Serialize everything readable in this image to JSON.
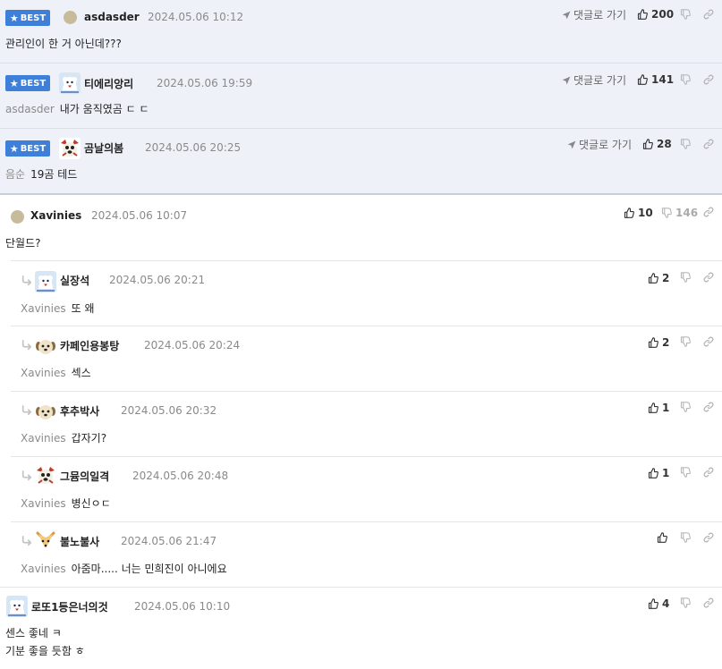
{
  "ui": {
    "best_label": "BEST",
    "goto_label": "댓글로 가기"
  },
  "best_comments": [
    {
      "nickname": "asdasder",
      "date": "2024.05.06 10:12",
      "mention": "",
      "text": "관리인이 한 거 아닌데???",
      "likes": "200",
      "avatar": "dot"
    },
    {
      "nickname": "티에리앙리",
      "date": "2024.05.06 19:59",
      "mention": "asdasder",
      "text": "내가 움직였곰 ㄷ ㄷ",
      "likes": "141",
      "avatar": "bear"
    },
    {
      "nickname": "곰날의봄",
      "date": "2024.05.06 20:25",
      "mention": "음순",
      "text": "19곰 테드",
      "likes": "28",
      "avatar": "dog"
    }
  ],
  "comments": [
    {
      "nickname": "Xavinies",
      "date": "2024.05.06 10:07",
      "text": "단월드?",
      "likes": "10",
      "dislikes": "146",
      "avatar": "dot"
    },
    {
      "nickname": "실장석",
      "date": "2024.05.06 20:21",
      "mention": "Xavinies",
      "text": "또 왜",
      "likes": "2",
      "avatar": "bear"
    },
    {
      "nickname": "카페인용봉탕",
      "date": "2024.05.06 20:24",
      "mention": "Xavinies",
      "text": "섹스",
      "likes": "2",
      "avatar": "puppy"
    },
    {
      "nickname": "후추박사",
      "date": "2024.05.06 20:32",
      "mention": "Xavinies",
      "text": "갑자기?",
      "likes": "1",
      "avatar": "puppy"
    },
    {
      "nickname": "그뮴의일격",
      "date": "2024.05.06 20:48",
      "mention": "Xavinies",
      "text": "병신ㅇㄷ",
      "likes": "1",
      "avatar": "dog"
    },
    {
      "nickname": "불노불사",
      "date": "2024.05.06 21:47",
      "mention": "Xavinies",
      "text": "아줌마..... 너는 민희진이 아니에요",
      "likes": "",
      "avatar": "fox"
    },
    {
      "nickname": "로또1등은너의것",
      "date": "2024.05.06 10:10",
      "text_line1": "센스 좋네 ㅋ",
      "text_line2": "기분 좋을 듯함 ㅎ",
      "likes": "4",
      "avatar": "bear"
    }
  ],
  "colors": {
    "best_badge": "#3d7fd9",
    "best_background": "#eef2f8",
    "muted_text": "#8a8a8a"
  },
  "icons": [
    "star-icon",
    "send-icon",
    "thumbs-up-icon",
    "thumbs-down-icon",
    "link-icon",
    "reply-arrow-icon"
  ]
}
